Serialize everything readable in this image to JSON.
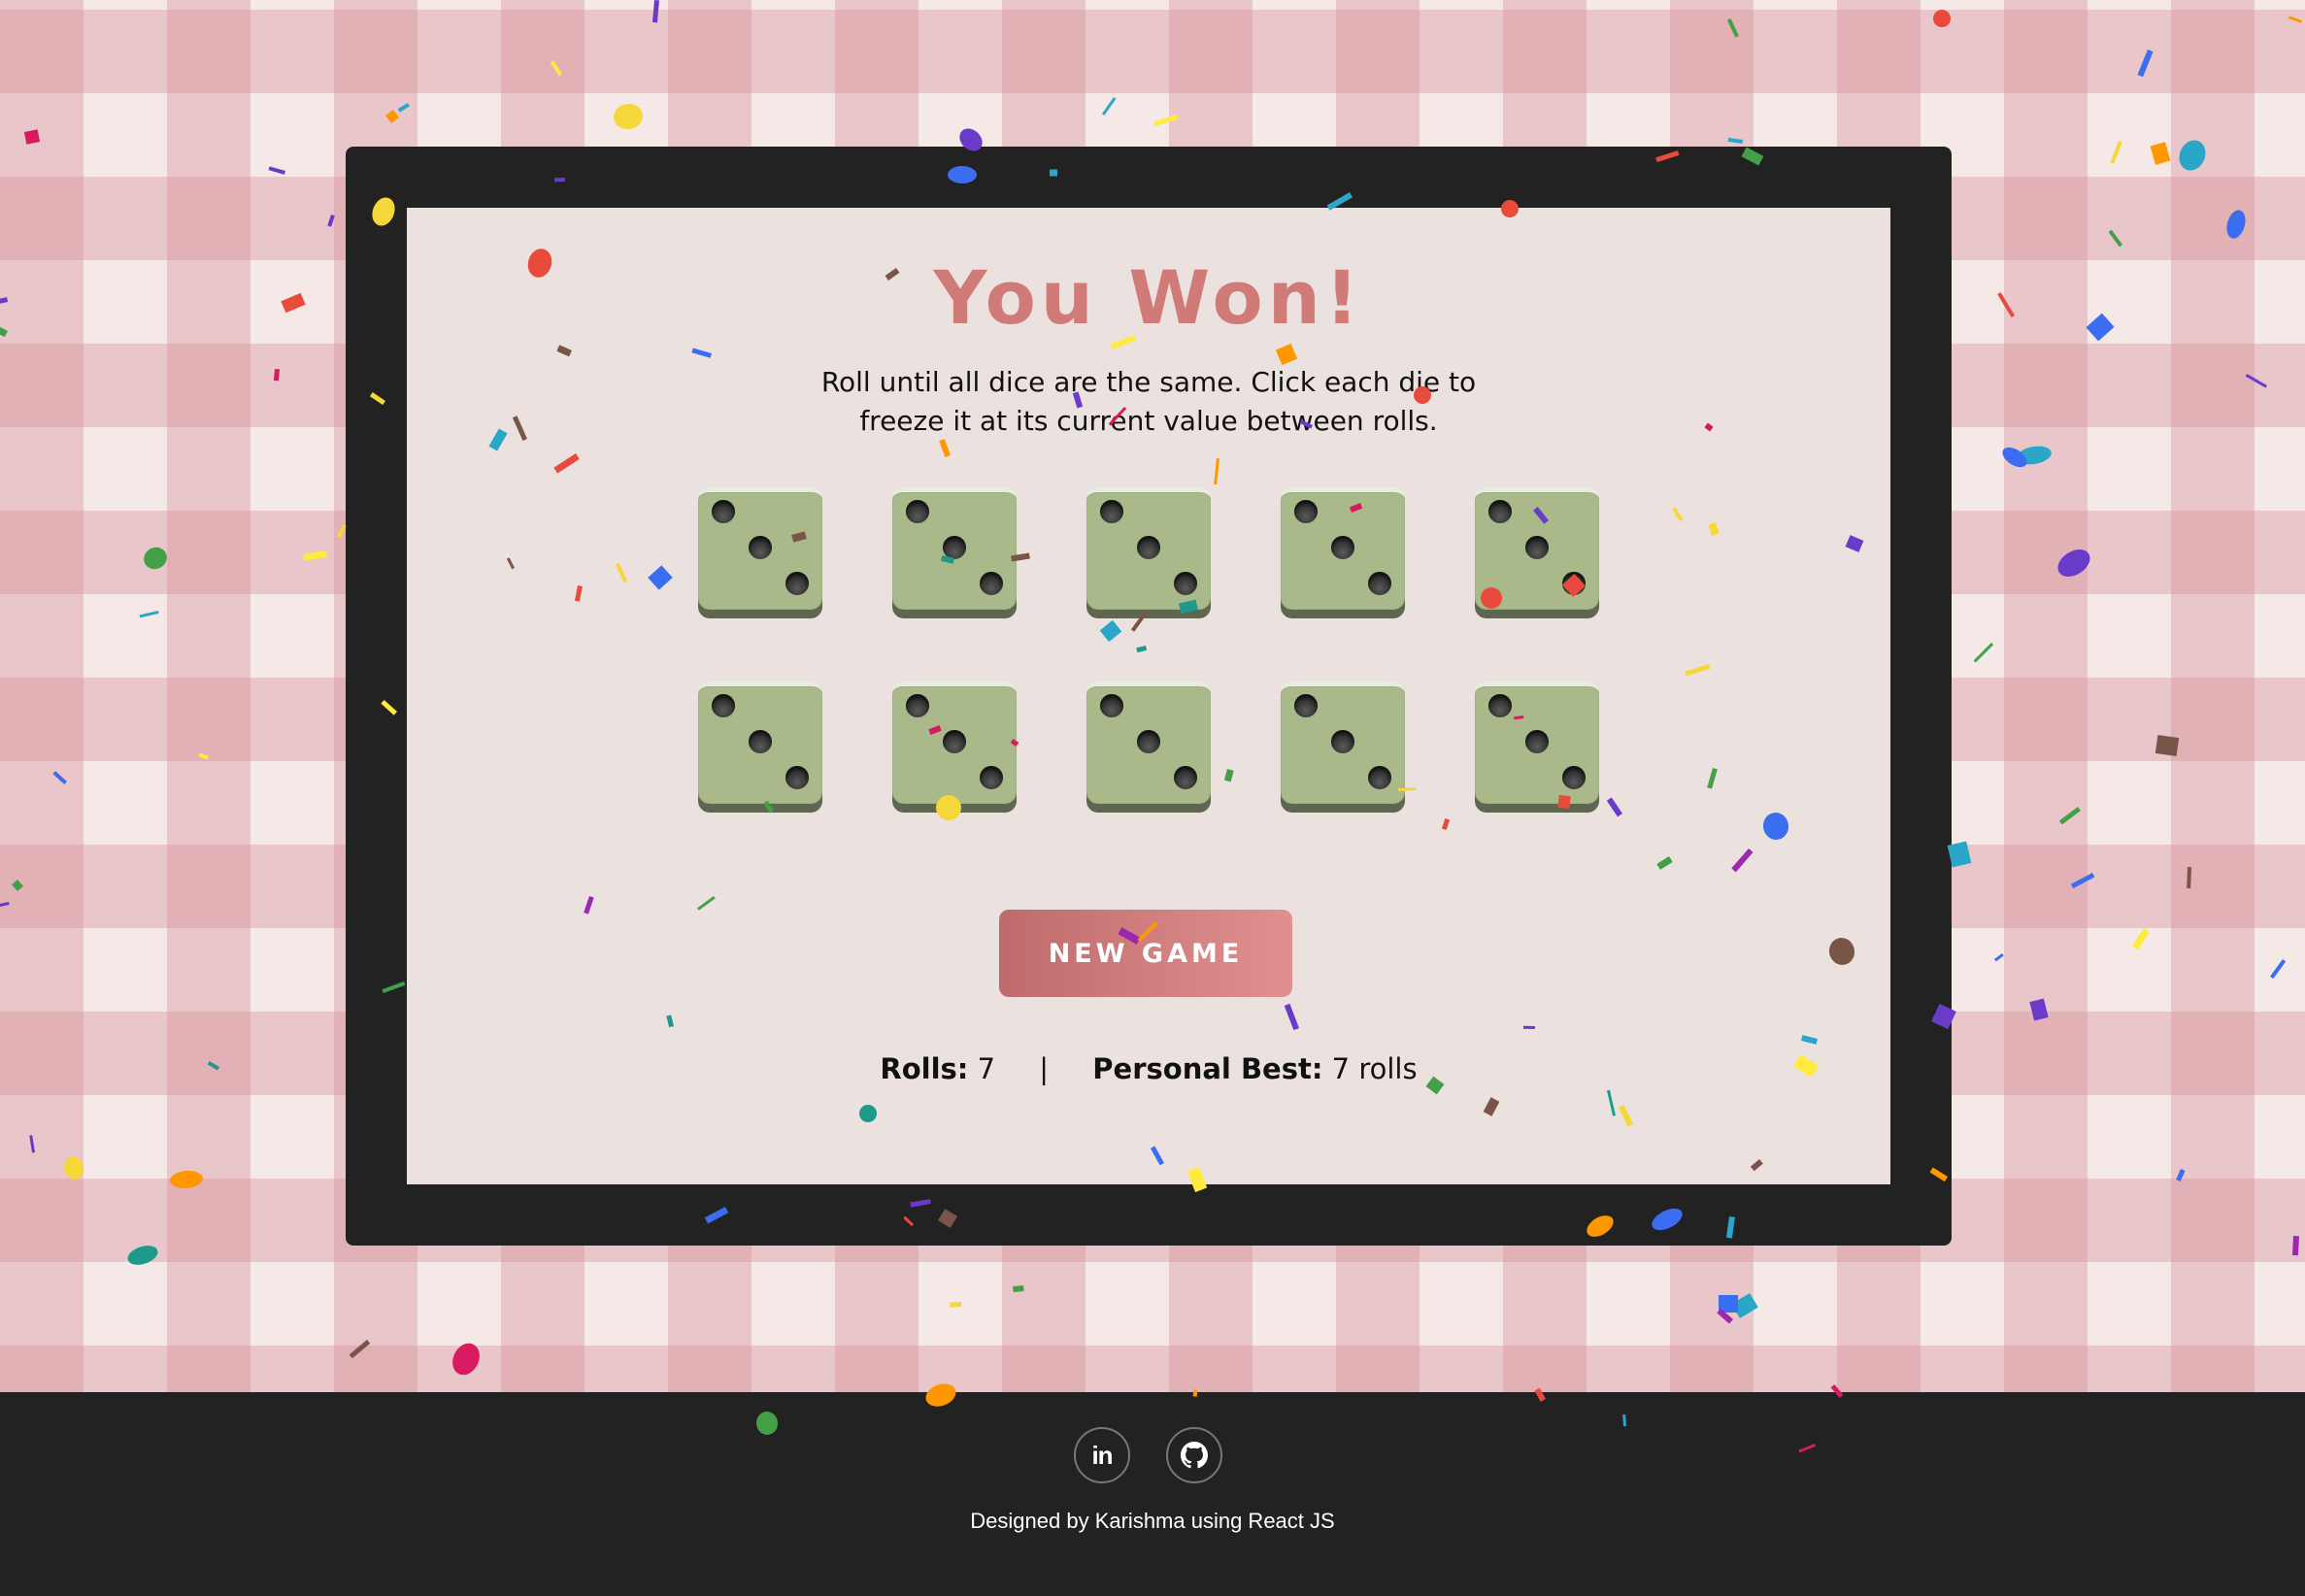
{
  "game": {
    "title": "You Won!",
    "instructions": "Roll until all dice are the same. Click each die to freeze it at its current value between rolls.",
    "dice": [
      3,
      3,
      3,
      3,
      3,
      3,
      3,
      3,
      3,
      3
    ],
    "button_label": "NEW GAME",
    "stats": {
      "rolls_label": "Rolls:",
      "rolls_value": "7",
      "separator": "|",
      "best_label": "Personal Best:",
      "best_value": "7 rolls"
    }
  },
  "footer": {
    "icons": [
      "linkedin-icon",
      "github-icon"
    ],
    "linkedin_glyph": "in",
    "credit": "Designed by Karishma using React JS"
  },
  "colors": {
    "frame": "#222222",
    "board": "#ebe2e0",
    "title": "#d07b78",
    "die": "#a9b98a",
    "button_start": "#bf6b6d",
    "button_end": "#e0908f",
    "footer": "#222222"
  }
}
